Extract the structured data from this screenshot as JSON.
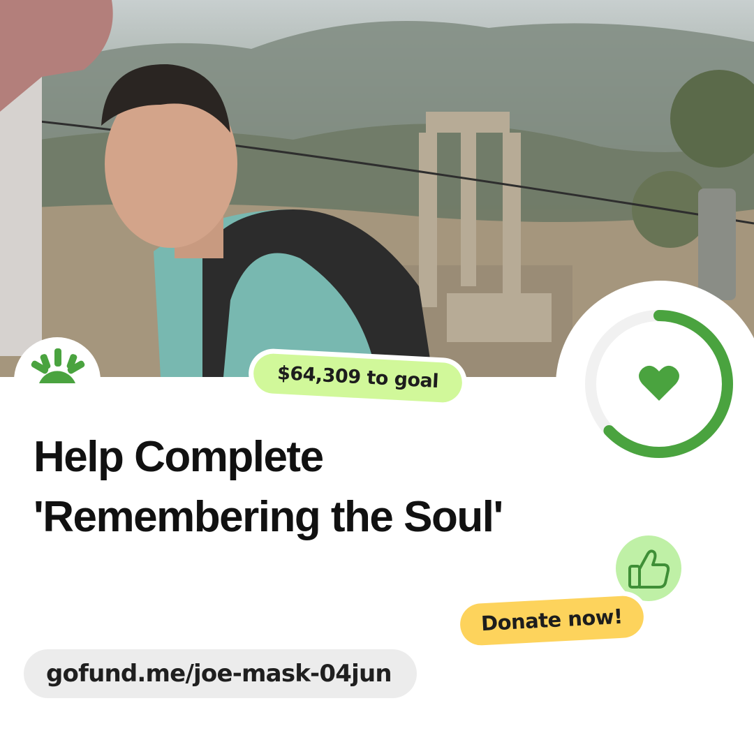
{
  "campaign": {
    "goal_text": "$64,309 to goal",
    "title_line1": "Help Complete",
    "title_line2": "'Remembering the Soul'",
    "donate_label": "Donate now!",
    "url": "gofund.me/joe-mask-04jun",
    "progress_fraction": 0.63
  },
  "icons": {
    "brand_logo": "gofundme-sunrise-icon",
    "progress_center": "heart-icon",
    "badge": "thumbs-up-icon"
  },
  "colors": {
    "brand_green": "#4aa33f",
    "ring_track": "#f1f1f1",
    "goal_pill": "#d1f89a",
    "donate_button": "#fdd35c",
    "url_pill": "#ececec",
    "thumb_bubble": "#bff0a6",
    "title_text": "#111111"
  }
}
